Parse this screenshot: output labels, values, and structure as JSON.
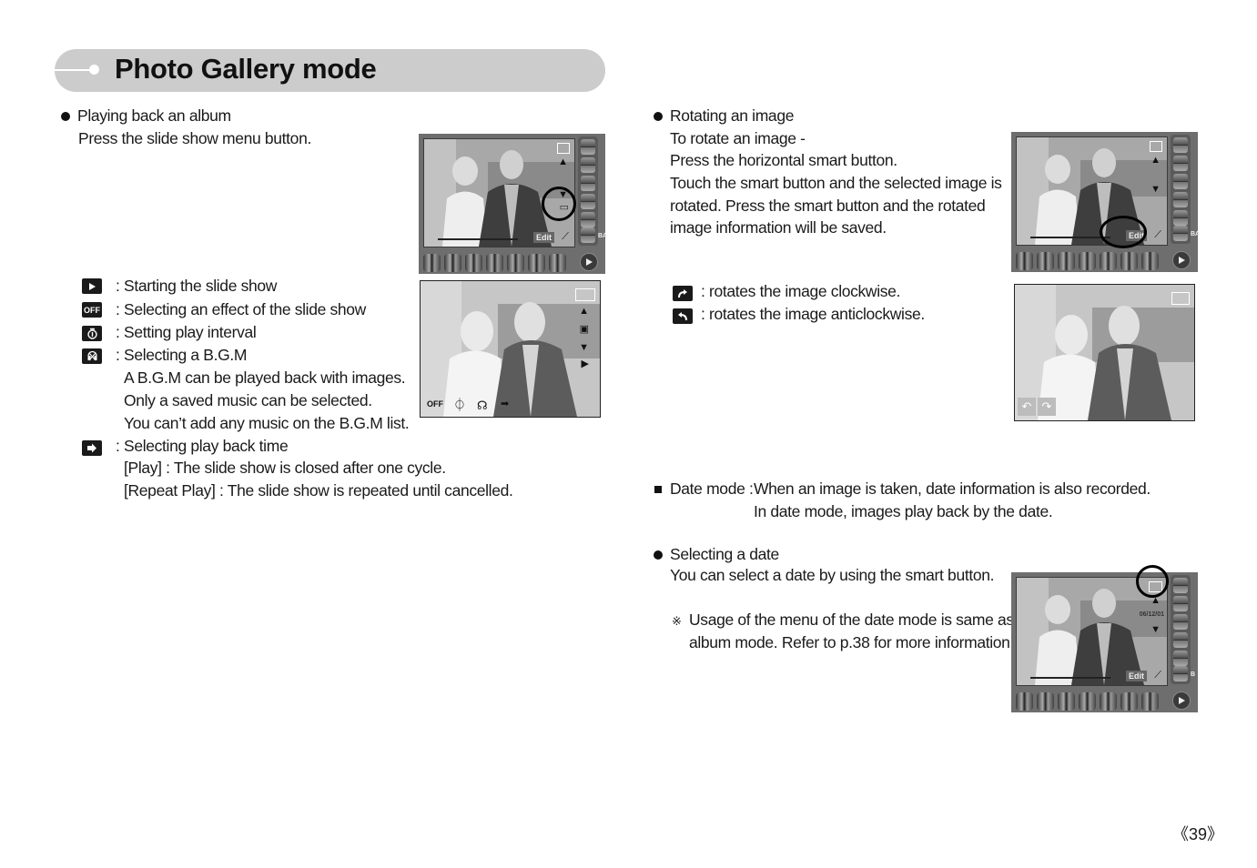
{
  "header": {
    "title": "Photo Gallery mode"
  },
  "left": {
    "section_title": "Playing back an album",
    "intro": "Press the slide show menu button.",
    "legend": [
      {
        "icon": "play-icon",
        "text": ": Starting the slide show"
      },
      {
        "icon": "off-icon",
        "icon_text": "OFF",
        "text": ": Selecting an effect of the slide show"
      },
      {
        "icon": "timer-icon",
        "text": ": Setting play interval"
      },
      {
        "icon": "bgm-icon",
        "text": ": Selecting a B.G.M"
      }
    ],
    "bgm_notes": [
      "A B.G.M can be played back with images.",
      "Only a saved music can be selected.",
      "You can’t add any music on the B.G.M list."
    ],
    "playback": {
      "icon": "arrow-right-icon",
      "text": ": Selecting play back time"
    },
    "playback_notes": [
      "[Play] : The slide show is closed after one cycle.",
      "[Repeat Play] : The slide show is repeated until cancelled."
    ],
    "screen1": {
      "edit_label": "Edit",
      "side_label": "BA"
    },
    "screen2": {
      "off_label": "OFF"
    }
  },
  "right": {
    "rotate": {
      "section_title": "Rotating an image",
      "lines": [
        "To rotate an image -",
        "Press the horizontal smart button.",
        "Touch the smart button and the selected image is",
        "rotated. Press the smart button and the rotated",
        "image information will be saved."
      ],
      "legend": [
        {
          "icon": "rotate-clockwise-icon",
          "text": ": rotates the image clockwise."
        },
        {
          "icon": "rotate-anticlockwise-icon",
          "text": ": rotates the image anticlockwise."
        }
      ],
      "screen": {
        "edit_label": "Edit",
        "side_label": "BA"
      }
    },
    "date_mode": {
      "label": "Date mode :",
      "line1": "When an image is taken, date information is also recorded.",
      "line2": "In date mode, images play back by the date."
    },
    "select_date": {
      "section_title": "Selecting a date",
      "line": "You can select a date by using the smart button.",
      "note_mark": "※",
      "note_lines": [
        "Usage of the menu of the date mode is same as",
        "album mode. Refer to p.38 for more information."
      ],
      "screen": {
        "date": "06/12/01",
        "edit_label": "Edit",
        "side_label": "B"
      }
    }
  },
  "footer": {
    "page_number": "《39》"
  }
}
